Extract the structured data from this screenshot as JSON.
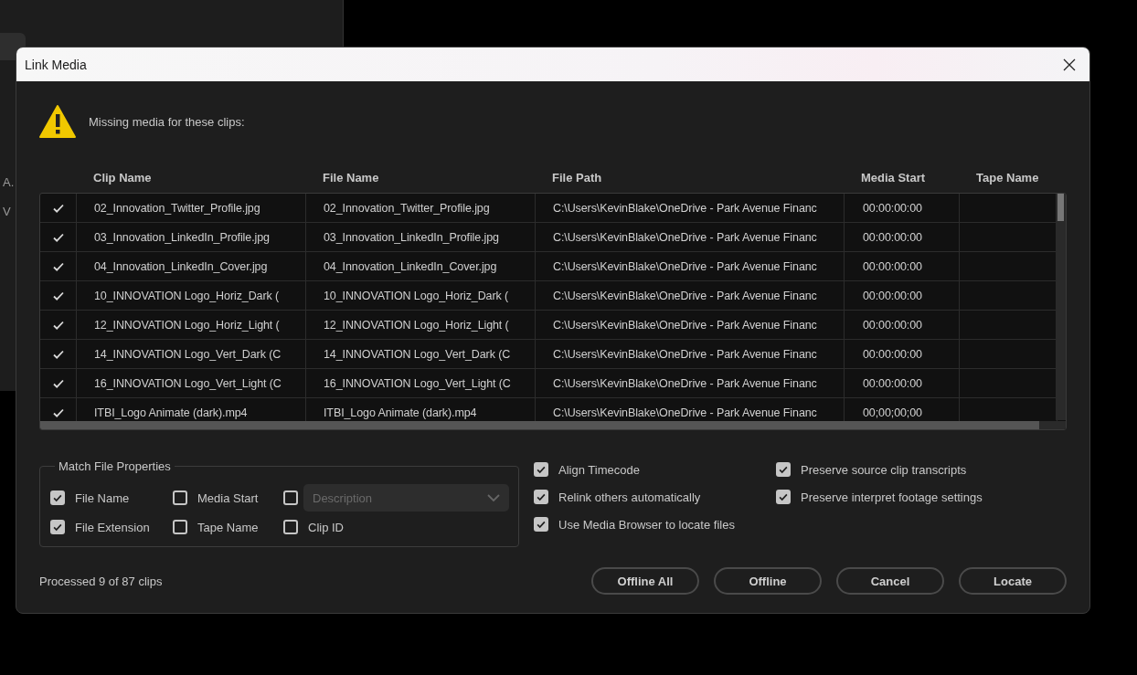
{
  "background_panel": {
    "labels": [
      "A.",
      "V"
    ]
  },
  "dialog": {
    "title": "Link Media",
    "message": "Missing media for these clips:"
  },
  "table": {
    "columns": [
      "Clip Name",
      "File Name",
      "File Path",
      "Media Start",
      "Tape Name"
    ],
    "rows": [
      {
        "checked": true,
        "cells": [
          "02_Innovation_Twitter_Profile.jpg",
          "02_Innovation_Twitter_Profile.jpg",
          "C:\\Users\\KevinBlake\\OneDrive - Park Avenue Financ",
          "00:00:00:00",
          ""
        ]
      },
      {
        "checked": true,
        "cells": [
          "03_Innovation_LinkedIn_Profile.jpg",
          "03_Innovation_LinkedIn_Profile.jpg",
          "C:\\Users\\KevinBlake\\OneDrive - Park Avenue Financ",
          "00:00:00:00",
          ""
        ]
      },
      {
        "checked": true,
        "cells": [
          "04_Innovation_LinkedIn_Cover.jpg",
          "04_Innovation_LinkedIn_Cover.jpg",
          "C:\\Users\\KevinBlake\\OneDrive - Park Avenue Financ",
          "00:00:00:00",
          ""
        ]
      },
      {
        "checked": true,
        "cells": [
          "10_INNOVATION Logo_Horiz_Dark (",
          "10_INNOVATION Logo_Horiz_Dark (",
          "C:\\Users\\KevinBlake\\OneDrive - Park Avenue Financ",
          "00:00:00:00",
          ""
        ]
      },
      {
        "checked": true,
        "cells": [
          "12_INNOVATION Logo_Horiz_Light (",
          "12_INNOVATION Logo_Horiz_Light (",
          "C:\\Users\\KevinBlake\\OneDrive - Park Avenue Financ",
          "00:00:00:00",
          ""
        ]
      },
      {
        "checked": true,
        "cells": [
          "14_INNOVATION Logo_Vert_Dark (C",
          "14_INNOVATION Logo_Vert_Dark (C",
          "C:\\Users\\KevinBlake\\OneDrive - Park Avenue Financ",
          "00:00:00:00",
          ""
        ]
      },
      {
        "checked": true,
        "cells": [
          "16_INNOVATION Logo_Vert_Light (C",
          "16_INNOVATION Logo_Vert_Light (C",
          "C:\\Users\\KevinBlake\\OneDrive - Park Avenue Financ",
          "00:00:00:00",
          ""
        ]
      },
      {
        "checked": true,
        "cells": [
          "ITBI_Logo Animate (dark).mp4",
          "ITBI_Logo Animate (dark).mp4",
          "C:\\Users\\KevinBlake\\OneDrive - Park Avenue Financ",
          "00;00;00;00",
          ""
        ]
      }
    ]
  },
  "match_properties": {
    "title": "Match File Properties",
    "options": [
      {
        "kind": "checkbox",
        "label": "File Name",
        "checked": true
      },
      {
        "kind": "checkbox",
        "label": "Media Start",
        "checked": false
      },
      {
        "kind": "dropdown",
        "checked": false,
        "disabled": true,
        "placeholder": "Description"
      },
      {
        "kind": "checkbox",
        "label": "File Extension",
        "checked": true
      },
      {
        "kind": "checkbox",
        "label": "Tape Name",
        "checked": false
      },
      {
        "kind": "checkbox",
        "label": "Clip ID",
        "checked": false
      }
    ]
  },
  "options": [
    {
      "label": "Align Timecode",
      "checked": true
    },
    {
      "label": "Preserve source clip transcripts",
      "checked": true
    },
    {
      "label": "Relink others automatically",
      "checked": true
    },
    {
      "label": "Preserve interpret footage settings",
      "checked": true
    },
    {
      "label": "Use Media Browser to locate files",
      "checked": true
    }
  ],
  "status": "Processed 9 of 87 clips",
  "buttons": [
    "Offline All",
    "Offline",
    "Cancel",
    "Locate"
  ]
}
